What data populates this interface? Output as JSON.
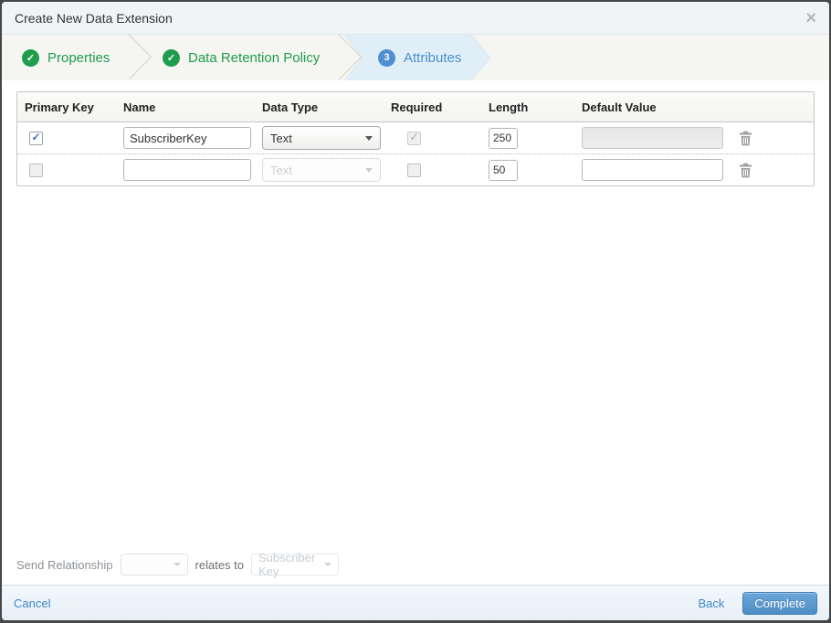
{
  "modal": {
    "title": "Create New Data Extension"
  },
  "icons": {
    "close": "×",
    "check": "✓"
  },
  "wizard": {
    "steps": [
      {
        "label": "Properties",
        "status": "complete"
      },
      {
        "label": "Data Retention Policy",
        "status": "complete"
      },
      {
        "label": "Attributes",
        "status": "active",
        "number": "3"
      }
    ]
  },
  "table": {
    "headers": {
      "primary_key": "Primary Key",
      "name": "Name",
      "data_type": "Data Type",
      "required": "Required",
      "length": "Length",
      "default_value": "Default Value"
    },
    "rows": [
      {
        "primary_key": true,
        "name": "SubscriberKey",
        "data_type": "Text",
        "required": true,
        "length": "250",
        "default_value": ""
      },
      {
        "primary_key": false,
        "name": "",
        "data_type": "Text",
        "required": false,
        "length": "50",
        "default_value": ""
      }
    ]
  },
  "relationship": {
    "label": "Send Relationship",
    "relates_to": "relates to",
    "target": "Subscriber Key"
  },
  "footer": {
    "cancel": "Cancel",
    "back": "Back",
    "complete": "Complete"
  },
  "colors": {
    "step_complete_green": "#1f9d4d",
    "step_active_blue": "#4a90c9",
    "step_active_bg": "#e0eef8",
    "primary_button_blue": "#4d8dc5",
    "link_blue": "#3e86c7",
    "titlebar_bg": "#f0f4f7",
    "steps_bg": "#f5f5f2",
    "footer_bg": "#eef5fa"
  }
}
